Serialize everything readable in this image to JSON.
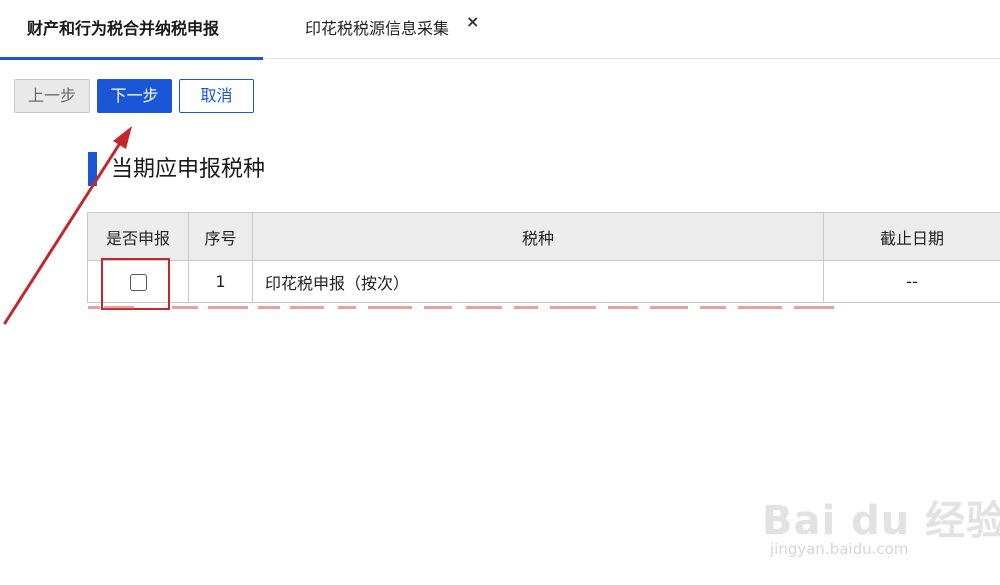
{
  "tabs": [
    {
      "label": "财产和行为税合并纳税申报",
      "active": true
    },
    {
      "label": "印花税税源信息采集",
      "active": false,
      "closable": true
    }
  ],
  "tab_close_symbol": "×",
  "toolbar": {
    "prev_label": "上一步",
    "next_label": "下一步",
    "cancel_label": "取消"
  },
  "section": {
    "title": "当期应申报税种"
  },
  "table": {
    "headers": [
      "是否申报",
      "序号",
      "税种",
      "截止日期"
    ],
    "rows": [
      {
        "declare_checked": false,
        "index": "1",
        "tax_type": "印花税申报（按次）",
        "deadline": "--"
      }
    ]
  },
  "watermark": {
    "brand": "Bai du 经验",
    "url": "jingyan.baidu.com"
  },
  "colors": {
    "accent": "#1a56d6",
    "annotation_red": "#c1272d",
    "header_bg": "#ececec"
  },
  "icons": [
    "close-icon",
    "checkbox-icon",
    "annotation-arrow-icon"
  ]
}
